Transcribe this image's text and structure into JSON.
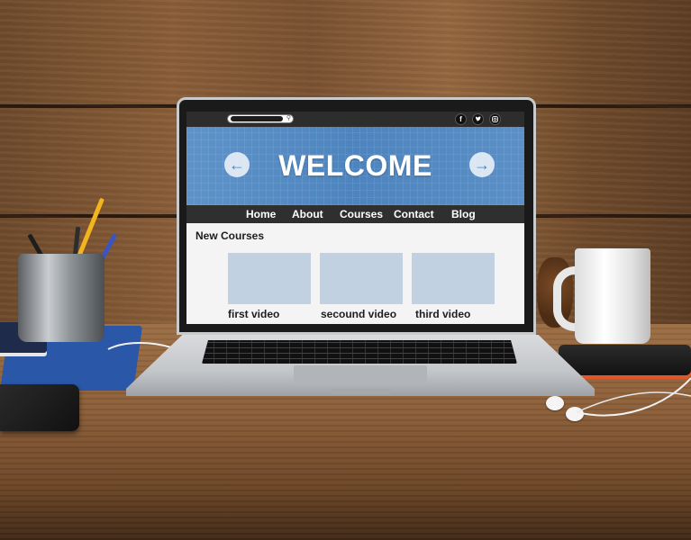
{
  "site": {
    "hero_title": "WELCOME",
    "nav": [
      "Home",
      "About",
      "Courses",
      "Contact",
      "Blog"
    ],
    "section_title": "New Courses",
    "courses": [
      "first video",
      "secound video",
      "third video"
    ],
    "social": [
      "f",
      "t",
      "ig"
    ],
    "prev_icon": "arrow-left-icon",
    "next_icon": "arrow-right-icon"
  },
  "colors": {
    "hero": "#4e84bd",
    "nav": "#2f2f2f",
    "thumbnail": "#c2d1e2"
  }
}
